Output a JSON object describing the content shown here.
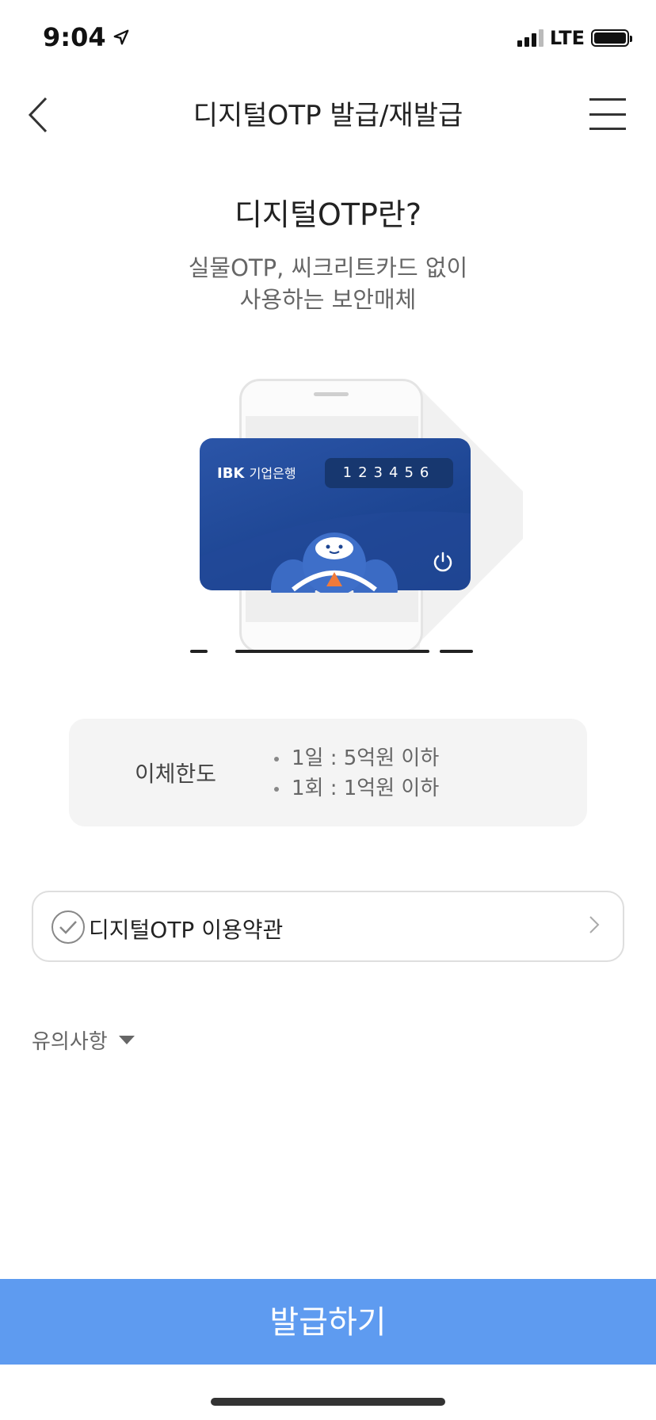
{
  "status_bar": {
    "time": "9:04",
    "network": "LTE"
  },
  "header": {
    "title": "디지털OTP 발급/재발급"
  },
  "hero": {
    "title": "디지털OTP란?",
    "subtitle_line1": "실물OTP, 씨크리트카드 없이",
    "subtitle_line2": "사용하는 보안매체"
  },
  "card": {
    "brand": "IBK",
    "brand_sub": "기업은행",
    "otp_digits": "123456"
  },
  "limits": {
    "label": "이체한도",
    "items": [
      "1일 : 5억원 이하",
      "1회 : 1억원 이하"
    ]
  },
  "terms": {
    "label": "디지털OTP 이용약관"
  },
  "notes": {
    "label": "유의사항"
  },
  "actions": {
    "issue_label": "발급하기"
  },
  "colors": {
    "primary_button": "#5e9bf0",
    "card_blue": "#1d4592",
    "limit_bg": "#f4f4f4"
  },
  "icons": [
    "location-arrow-icon",
    "signal-icon",
    "battery-icon",
    "back-chevron-icon",
    "hamburger-menu-icon",
    "power-icon",
    "check-circle-icon",
    "chevron-right-icon",
    "caret-down-icon"
  ]
}
